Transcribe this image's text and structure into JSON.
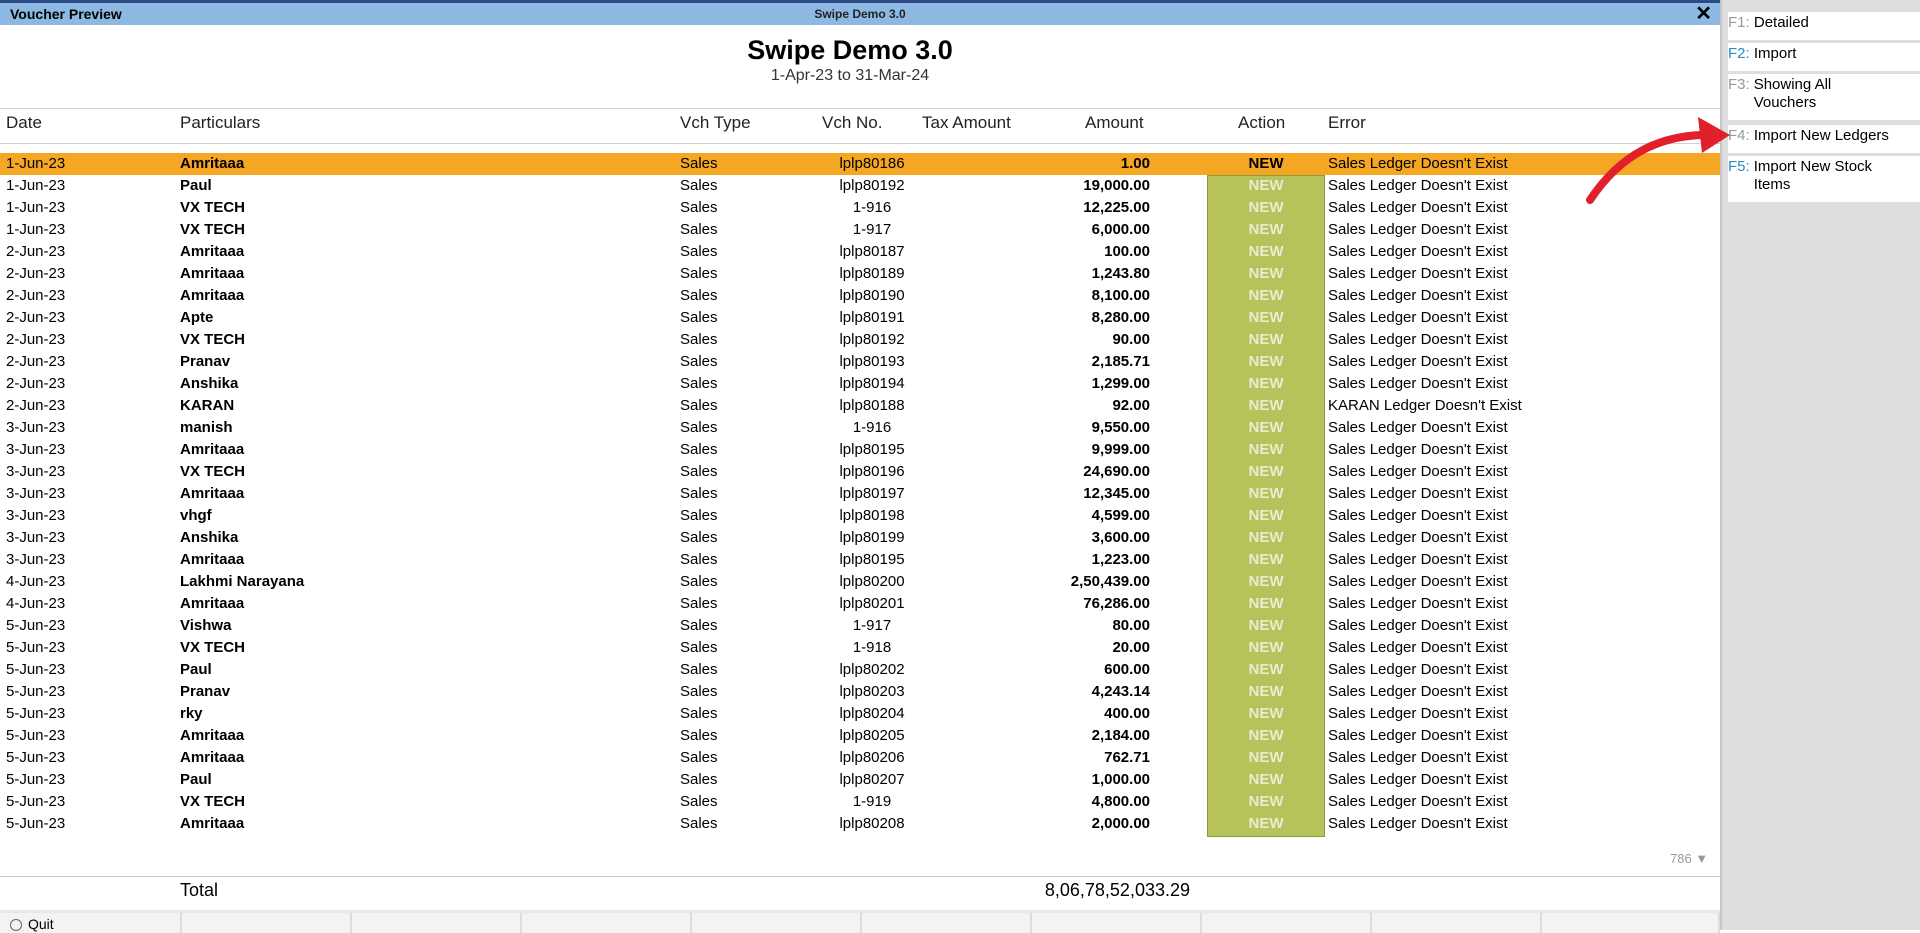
{
  "window": {
    "left_title": "Voucher Preview",
    "center_title": "Swipe Demo 3.0",
    "close_label": "✕"
  },
  "report": {
    "company": "Swipe Demo 3.0",
    "period": "1-Apr-23 to 31-Mar-24"
  },
  "columns": {
    "date": "Date",
    "particulars": "Particulars",
    "vch_type": "Vch Type",
    "vch_no": "Vch No.",
    "tax_amount": "Tax Amount",
    "amount": "Amount",
    "action": "Action",
    "error": "Error"
  },
  "rows": [
    {
      "date": "1-Jun-23",
      "particulars": "Amritaaa",
      "vch_type": "Sales",
      "vch_no": "lplp80186",
      "amount": "1.00",
      "action": "NEW",
      "error": "Sales Ledger Doesn't Exist"
    },
    {
      "date": "1-Jun-23",
      "particulars": "Paul",
      "vch_type": "Sales",
      "vch_no": "lplp80192",
      "amount": "19,000.00",
      "action": "NEW",
      "error": "Sales Ledger Doesn't Exist"
    },
    {
      "date": "1-Jun-23",
      "particulars": "VX TECH",
      "vch_type": "Sales",
      "vch_no": "1-916",
      "amount": "12,225.00",
      "action": "NEW",
      "error": "Sales Ledger Doesn't Exist"
    },
    {
      "date": "1-Jun-23",
      "particulars": "VX TECH",
      "vch_type": "Sales",
      "vch_no": "1-917",
      "amount": "6,000.00",
      "action": "NEW",
      "error": "Sales Ledger Doesn't Exist"
    },
    {
      "date": "2-Jun-23",
      "particulars": "Amritaaa",
      "vch_type": "Sales",
      "vch_no": "lplp80187",
      "amount": "100.00",
      "action": "NEW",
      "error": "Sales Ledger Doesn't Exist"
    },
    {
      "date": "2-Jun-23",
      "particulars": "Amritaaa",
      "vch_type": "Sales",
      "vch_no": "lplp80189",
      "amount": "1,243.80",
      "action": "NEW",
      "error": "Sales Ledger Doesn't Exist"
    },
    {
      "date": "2-Jun-23",
      "particulars": "Amritaaa",
      "vch_type": "Sales",
      "vch_no": "lplp80190",
      "amount": "8,100.00",
      "action": "NEW",
      "error": "Sales Ledger Doesn't Exist"
    },
    {
      "date": "2-Jun-23",
      "particulars": "Apte",
      "vch_type": "Sales",
      "vch_no": "lplp80191",
      "amount": "8,280.00",
      "action": "NEW",
      "error": "Sales Ledger Doesn't Exist"
    },
    {
      "date": "2-Jun-23",
      "particulars": "VX TECH",
      "vch_type": "Sales",
      "vch_no": "lplp80192",
      "amount": "90.00",
      "action": "NEW",
      "error": "Sales Ledger Doesn't Exist"
    },
    {
      "date": "2-Jun-23",
      "particulars": "Pranav",
      "vch_type": "Sales",
      "vch_no": "lplp80193",
      "amount": "2,185.71",
      "action": "NEW",
      "error": "Sales Ledger Doesn't Exist"
    },
    {
      "date": "2-Jun-23",
      "particulars": "Anshika",
      "vch_type": "Sales",
      "vch_no": "lplp80194",
      "amount": "1,299.00",
      "action": "NEW",
      "error": "Sales Ledger Doesn't Exist"
    },
    {
      "date": "2-Jun-23",
      "particulars": "KARAN",
      "vch_type": "Sales",
      "vch_no": "lplp80188",
      "amount": "92.00",
      "action": "NEW",
      "error": "KARAN Ledger Doesn't Exist"
    },
    {
      "date": "3-Jun-23",
      "particulars": "manish",
      "vch_type": "Sales",
      "vch_no": "1-916",
      "amount": "9,550.00",
      "action": "NEW",
      "error": "Sales Ledger Doesn't Exist"
    },
    {
      "date": "3-Jun-23",
      "particulars": "Amritaaa",
      "vch_type": "Sales",
      "vch_no": "lplp80195",
      "amount": "9,999.00",
      "action": "NEW",
      "error": "Sales Ledger Doesn't Exist"
    },
    {
      "date": "3-Jun-23",
      "particulars": "VX TECH",
      "vch_type": "Sales",
      "vch_no": "lplp80196",
      "amount": "24,690.00",
      "action": "NEW",
      "error": "Sales Ledger Doesn't Exist"
    },
    {
      "date": "3-Jun-23",
      "particulars": "Amritaaa",
      "vch_type": "Sales",
      "vch_no": "lplp80197",
      "amount": "12,345.00",
      "action": "NEW",
      "error": "Sales Ledger Doesn't Exist"
    },
    {
      "date": "3-Jun-23",
      "particulars": "vhgf",
      "vch_type": "Sales",
      "vch_no": "lplp80198",
      "amount": "4,599.00",
      "action": "NEW",
      "error": "Sales Ledger Doesn't Exist"
    },
    {
      "date": "3-Jun-23",
      "particulars": "Anshika",
      "vch_type": "Sales",
      "vch_no": "lplp80199",
      "amount": "3,600.00",
      "action": "NEW",
      "error": "Sales Ledger Doesn't Exist"
    },
    {
      "date": "3-Jun-23",
      "particulars": "Amritaaa",
      "vch_type": "Sales",
      "vch_no": "lplp80195",
      "amount": "1,223.00",
      "action": "NEW",
      "error": "Sales Ledger Doesn't Exist"
    },
    {
      "date": "4-Jun-23",
      "particulars": "Lakhmi Narayana",
      "vch_type": "Sales",
      "vch_no": "lplp80200",
      "amount": "2,50,439.00",
      "action": "NEW",
      "error": "Sales Ledger Doesn't Exist"
    },
    {
      "date": "4-Jun-23",
      "particulars": "Amritaaa",
      "vch_type": "Sales",
      "vch_no": "lplp80201",
      "amount": "76,286.00",
      "action": "NEW",
      "error": "Sales Ledger Doesn't Exist"
    },
    {
      "date": "5-Jun-23",
      "particulars": "Vishwa",
      "vch_type": "Sales",
      "vch_no": "1-917",
      "amount": "80.00",
      "action": "NEW",
      "error": "Sales Ledger Doesn't Exist"
    },
    {
      "date": "5-Jun-23",
      "particulars": "VX TECH",
      "vch_type": "Sales",
      "vch_no": "1-918",
      "amount": "20.00",
      "action": "NEW",
      "error": "Sales Ledger Doesn't Exist"
    },
    {
      "date": "5-Jun-23",
      "particulars": "Paul",
      "vch_type": "Sales",
      "vch_no": "lplp80202",
      "amount": "600.00",
      "action": "NEW",
      "error": "Sales Ledger Doesn't Exist"
    },
    {
      "date": "5-Jun-23",
      "particulars": "Pranav",
      "vch_type": "Sales",
      "vch_no": "lplp80203",
      "amount": "4,243.14",
      "action": "NEW",
      "error": "Sales Ledger Doesn't Exist"
    },
    {
      "date": "5-Jun-23",
      "particulars": "rky",
      "vch_type": "Sales",
      "vch_no": "lplp80204",
      "amount": "400.00",
      "action": "NEW",
      "error": "Sales Ledger Doesn't Exist"
    },
    {
      "date": "5-Jun-23",
      "particulars": "Amritaaa",
      "vch_type": "Sales",
      "vch_no": "lplp80205",
      "amount": "2,184.00",
      "action": "NEW",
      "error": "Sales Ledger Doesn't Exist"
    },
    {
      "date": "5-Jun-23",
      "particulars": "Amritaaa",
      "vch_type": "Sales",
      "vch_no": "lplp80206",
      "amount": "762.71",
      "action": "NEW",
      "error": "Sales Ledger Doesn't Exist"
    },
    {
      "date": "5-Jun-23",
      "particulars": "Paul",
      "vch_type": "Sales",
      "vch_no": "lplp80207",
      "amount": "1,000.00",
      "action": "NEW",
      "error": "Sales Ledger Doesn't Exist"
    },
    {
      "date": "5-Jun-23",
      "particulars": "VX TECH",
      "vch_type": "Sales",
      "vch_no": "1-919",
      "amount": "4,800.00",
      "action": "NEW",
      "error": "Sales Ledger Doesn't Exist"
    },
    {
      "date": "5-Jun-23",
      "particulars": "Amritaaa",
      "vch_type": "Sales",
      "vch_no": "lplp80208",
      "amount": "2,000.00",
      "action": "NEW",
      "error": "Sales Ledger Doesn't Exist"
    }
  ],
  "scroll_count": "786 ▼",
  "total": {
    "label": "Total",
    "amount": "8,06,78,52,033.29"
  },
  "footer": {
    "quit_label": "Quit"
  },
  "right_panel": [
    {
      "key": "F1:",
      "label": "Detailed",
      "active": false
    },
    {
      "key": "F2:",
      "label": "Import",
      "active": true
    },
    {
      "key": "F3:",
      "label": "Showing All Vouchers",
      "active": false
    },
    {
      "key": "F4:",
      "label": "Import New Ledgers",
      "active": false
    },
    {
      "key": "F5:",
      "label": "Import New Stock Items",
      "active": true
    }
  ],
  "colors": {
    "title_bar": "#8db8e2",
    "selected_row": "#f5a623",
    "action_band": "#b8c25a",
    "annotation_arrow": "#e0202a"
  }
}
